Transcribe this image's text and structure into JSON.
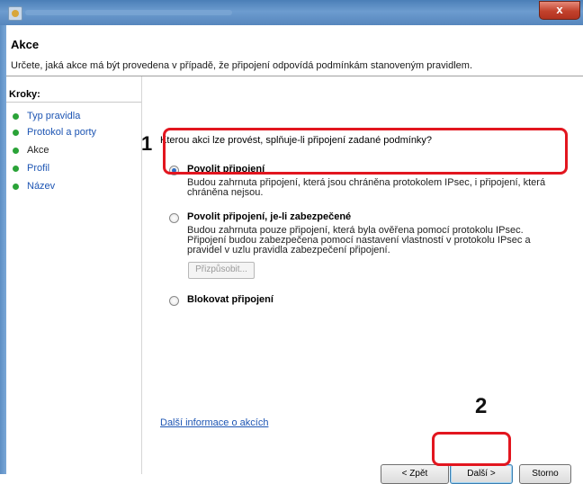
{
  "window": {
    "close_glyph": "x"
  },
  "header": {
    "title": "Akce",
    "description": "Určete, jaká akce má být provedena v případě, že připojení odpovídá podmínkám stanoveným pravidlem."
  },
  "steps": {
    "title": "Kroky:",
    "items": [
      {
        "label": "Typ pravidla",
        "state": "link"
      },
      {
        "label": "Protokol a porty",
        "state": "link"
      },
      {
        "label": "Akce",
        "state": "current"
      },
      {
        "label": "Profil",
        "state": "link"
      },
      {
        "label": "Název",
        "state": "link"
      }
    ],
    "dot_color": "#2aa338"
  },
  "main": {
    "question": "Kterou akci lze provést, splňuje-li připojení zadané podmínky?",
    "options": [
      {
        "label": "Povolit připojení",
        "description": "Budou zahrnuta připojení, která jsou chráněna protokolem IPsec, i připojení, která chráněna nejsou.",
        "checked": true
      },
      {
        "label": "Povolit připojení, je-li zabezpečené",
        "description": "Budou zahrnuta pouze připojení, která byla ověřena pomocí protokolu IPsec. Připojení budou zabezpečena pomocí nastavení vlastností v protokolu IPsec a pravidel v uzlu pravidla zabezpečení připojení.",
        "checked": false
      },
      {
        "label": "Blokovat připojení",
        "description": "",
        "checked": false
      }
    ],
    "customize_label": "Přizpůsobit...",
    "info_link": "Další informace o akcích"
  },
  "footer": {
    "back_label": "< Zpět",
    "next_label": "Další >",
    "cancel_label": "Storno"
  },
  "annotations": {
    "callout_1": "1",
    "callout_2": "2",
    "highlight_color": "#e2161f"
  }
}
